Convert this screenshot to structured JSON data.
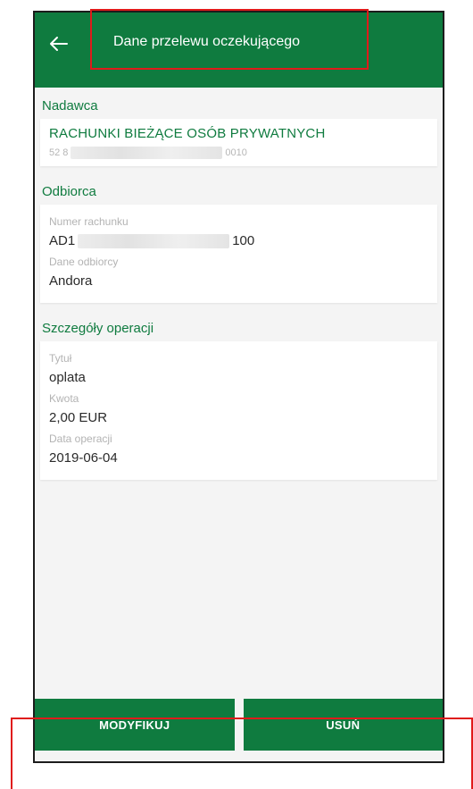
{
  "appbar": {
    "title": "Dane przelewu oczekującego",
    "back_icon": "arrow-left-icon"
  },
  "sender": {
    "section_label": "Nadawca",
    "account_name": "RACHUNKI BIEŻĄCE OSÓB PRYWATNYCH",
    "account_prefix": "52 8",
    "account_suffix": "0010"
  },
  "recipient": {
    "section_label": "Odbiorca",
    "account_number_label": "Numer rachunku",
    "account_prefix": "AD1",
    "account_suffix": "100",
    "recipient_data_label": "Dane odbiorcy",
    "recipient_data_value": "Andora"
  },
  "details": {
    "section_label": "Szczegóły operacji",
    "title_label": "Tytuł",
    "title_value": "oplata",
    "amount_label": "Kwota",
    "amount_value": "2,00 EUR",
    "date_label": "Data operacji",
    "date_value": "2019-06-04"
  },
  "actions": {
    "modify_label": "MODYFIKUJ",
    "delete_label": "USUŃ"
  },
  "colors": {
    "brand_green": "#0f7b3f",
    "highlight_red": "#e01b1b"
  }
}
